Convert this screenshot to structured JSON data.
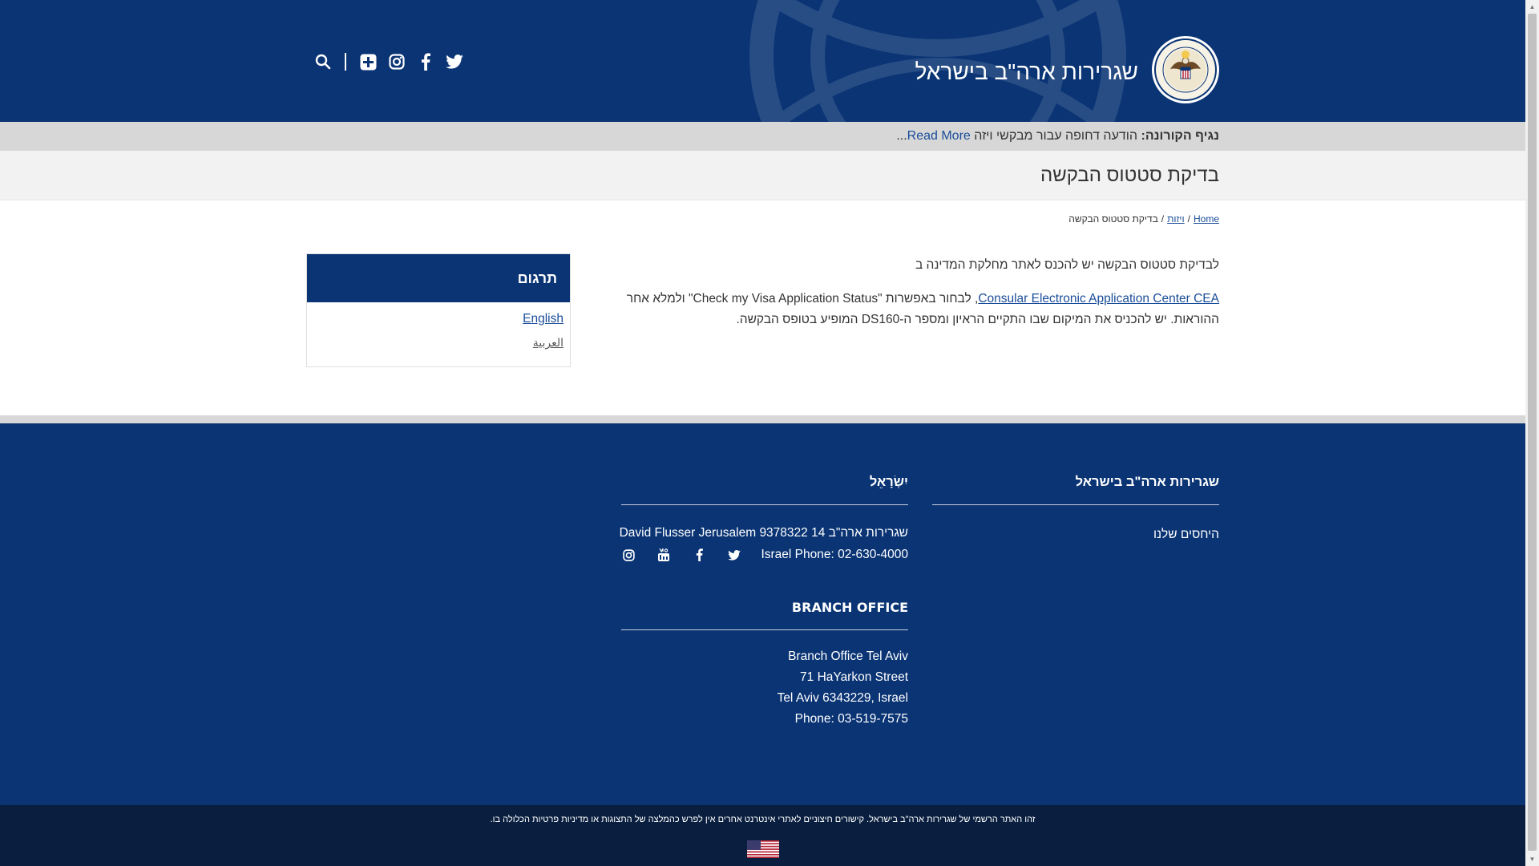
{
  "header": {
    "site_title": "שגרירות ארה\"ב בישראל",
    "icons": [
      "twitter-icon",
      "facebook-icon",
      "instagram-icon",
      "plus-icon",
      "search-icon"
    ]
  },
  "alert": {
    "prefix": "נגיף הקורונה:",
    "text": "הודעה דחופה עבור מבקשי ויזה",
    "read_more": "Read More",
    "ellipsis": "..."
  },
  "page": {
    "title": "בדיקת סטטוס הבקשה"
  },
  "breadcrumb": {
    "home": "Home",
    "sep1": "/",
    "visas": "ויזות",
    "sep2": "/",
    "current": "בדיקת סטטוס הבקשה"
  },
  "content": {
    "p1": "לבדיקת סטטוס הבקשה יש להכנס לאתר מחלקת המדינה ב",
    "cea_link": "Consular Electronic Application Center CEA",
    "p2_after_link": ", לבחור באפשרות \"Check my Visa Application Status\" ולמלא אחר ההוראות.   יש להכניס את המיקום שבו התקיים הראיון ומספר ה-DS160 המופיע בטופס הבקשה."
  },
  "translation_widget": {
    "title": "תרגום",
    "english": "English",
    "arabic": "العربية"
  },
  "footer": {
    "col1_title": "שגרירות ארה\"ב בישראל",
    "col1_link": "היחסים שלנו",
    "col2_title": "יִשְׂרָאֵל",
    "col2_address": "שגרירות ארה\"ב 14 David Flusser Jerusalem 9378322",
    "col2_phone": "Israel Phone: 02-630-4000",
    "col2_social": [
      "twitter-icon",
      "facebook-icon",
      "youtube-icon",
      "instagram-icon"
    ],
    "branch_title": "BRANCH OFFICE",
    "branch_line1": "Branch Office Tel Aviv",
    "branch_line2": "71 HaYarkon Street",
    "branch_line3": "Tel Aviv 6343229, Israel",
    "branch_line4": "Phone: 03-519-7575"
  },
  "bottom": {
    "disclaimer": "זהו האתר הרשמי של שגרירות ארה\"ב בישראל. קישורים חיצוניים לאתרי אינטרנט אחרים אין לפרש כהמלצה של התצוגות או מדיניות פרטיות הכלולה בו."
  },
  "colors": {
    "brand_navy": "#0a3474",
    "bottom_navy": "#0a1f3f",
    "link_blue": "#1a4d99",
    "alert_gray": "#d7d7d7"
  }
}
